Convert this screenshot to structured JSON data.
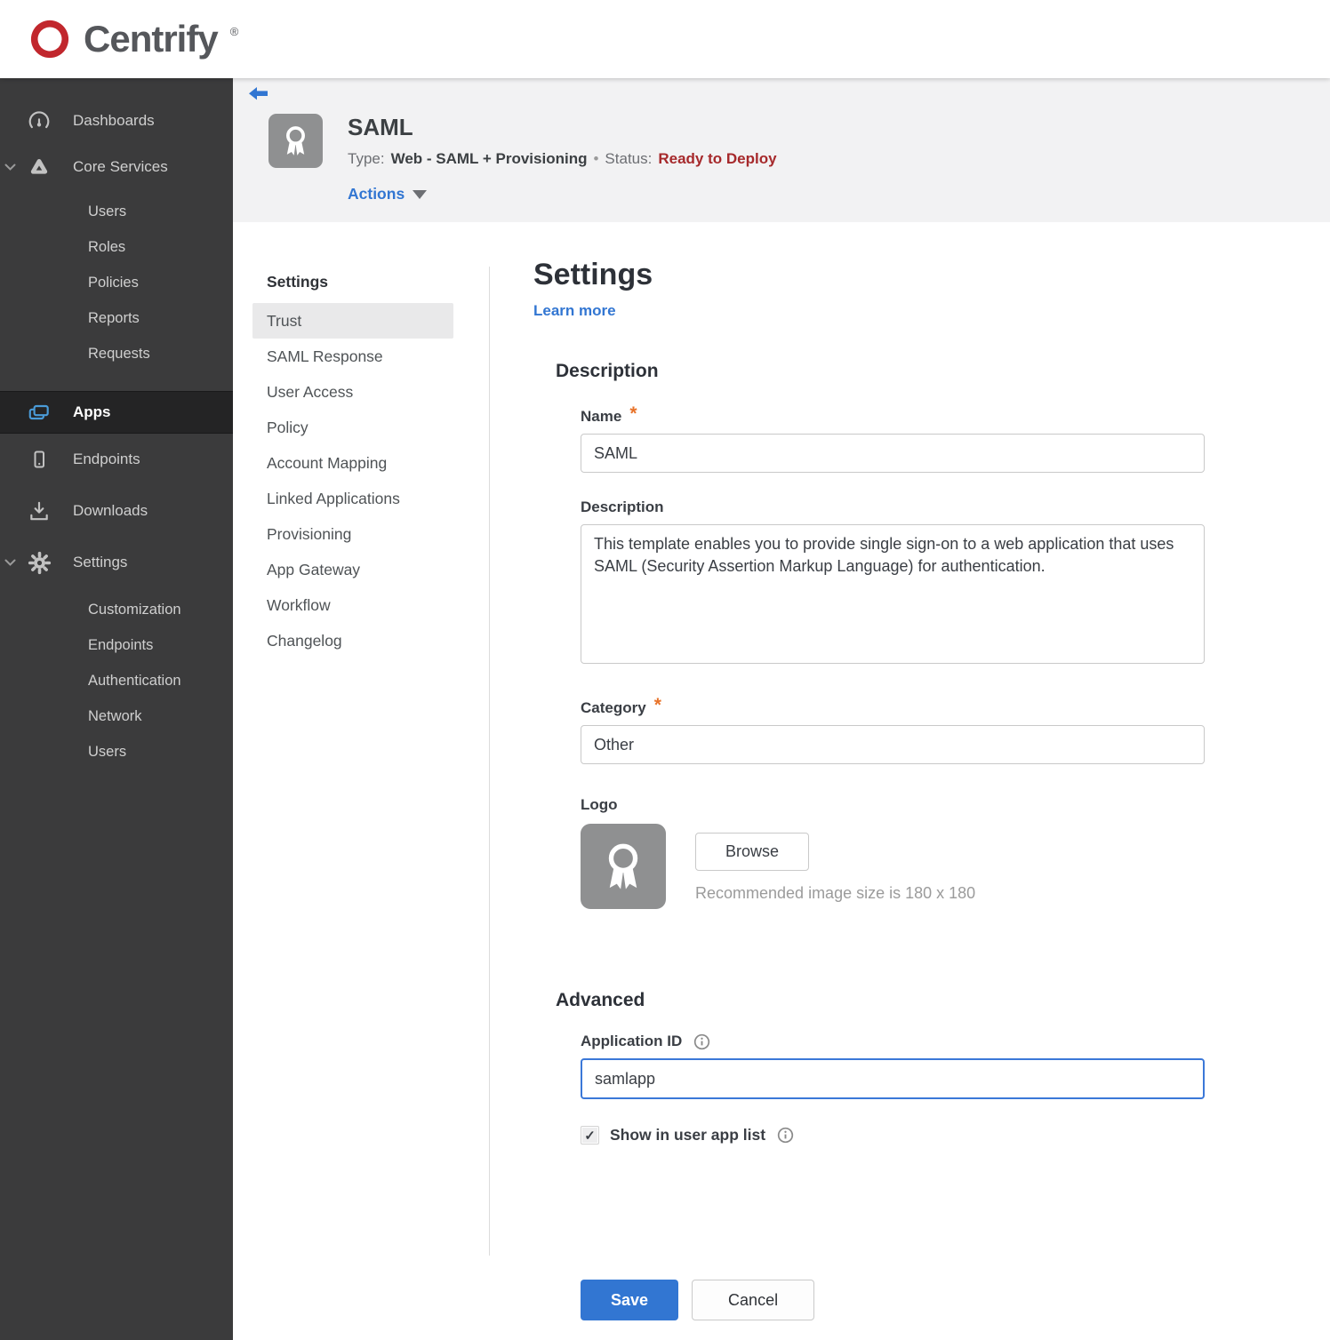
{
  "brand": {
    "name": "Centrify",
    "registered": "®",
    "logo_icon": "centrify-spiral-icon",
    "logo_color": "#c1272d"
  },
  "colors": {
    "accent_blue": "#3276d2",
    "status_red": "#a6292b",
    "required_orange": "#e8732a",
    "sidebar_bg": "#3b3b3c",
    "header_band": "#f2f2f3",
    "focus_border": "#3b78d8"
  },
  "sidebar": {
    "items": [
      {
        "label": "Dashboards",
        "icon": "gauge-icon"
      },
      {
        "label": "Core Services",
        "icon": "core-services-icon",
        "expanded": true,
        "children": [
          "Users",
          "Roles",
          "Policies",
          "Reports",
          "Requests"
        ]
      },
      {
        "label": "Apps",
        "icon": "apps-icon",
        "active": true
      },
      {
        "label": "Endpoints",
        "icon": "endpoint-phone-icon"
      },
      {
        "label": "Downloads",
        "icon": "download-icon"
      },
      {
        "label": "Settings",
        "icon": "gear-icon",
        "expanded": true,
        "children": [
          "Customization",
          "Endpoints",
          "Authentication",
          "Network",
          "Users"
        ]
      }
    ]
  },
  "app_header": {
    "back_icon": "back-arrow-icon",
    "app_icon": "ribbon-award-icon",
    "title": "SAML",
    "type_label": "Type:",
    "type_value": "Web - SAML + Provisioning",
    "separator": "•",
    "status_label": "Status:",
    "status_value": "Ready to Deploy",
    "actions_label": "Actions"
  },
  "subnav": {
    "header": "Settings",
    "items": [
      {
        "label": "Trust",
        "active": true
      },
      {
        "label": "SAML Response"
      },
      {
        "label": "User Access"
      },
      {
        "label": "Policy"
      },
      {
        "label": "Account Mapping"
      },
      {
        "label": "Linked Applications"
      },
      {
        "label": "Provisioning"
      },
      {
        "label": "App Gateway"
      },
      {
        "label": "Workflow"
      },
      {
        "label": "Changelog"
      }
    ]
  },
  "main": {
    "title": "Settings",
    "learn_more": "Learn more",
    "description_section": {
      "heading": "Description",
      "name": {
        "label": "Name",
        "required": "*",
        "value": "SAML"
      },
      "description": {
        "label": "Description",
        "value": "This template enables you to provide single sign-on to a web application that uses SAML (Security Assertion Markup Language) for authentication."
      },
      "category": {
        "label": "Category",
        "required": "*",
        "value": "Other"
      },
      "logo": {
        "label": "Logo",
        "preview_icon": "ribbon-award-icon",
        "browse_label": "Browse",
        "hint": "Recommended image size is 180 x 180"
      }
    },
    "advanced_section": {
      "heading": "Advanced",
      "application_id": {
        "label": "Application ID",
        "info_icon": "info-icon",
        "value": "samlapp"
      },
      "show_in_user_app_list": {
        "label": "Show in user app list",
        "checked": true,
        "check_glyph": "✓",
        "info_icon": "info-icon"
      }
    },
    "footer": {
      "save_label": "Save",
      "cancel_label": "Cancel"
    }
  }
}
